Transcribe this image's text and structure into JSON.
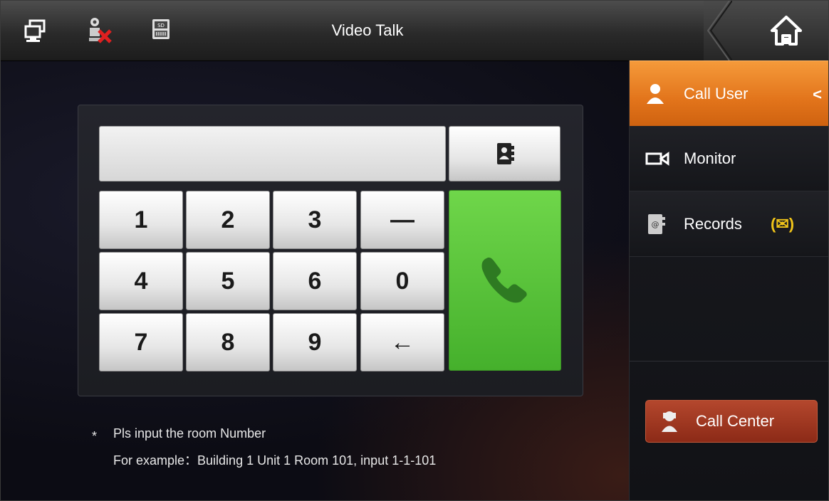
{
  "header": {
    "title": "Video Talk",
    "icons": [
      "windows-icon",
      "camera-error-icon",
      "sd-card-icon",
      "home-icon"
    ]
  },
  "keypad": {
    "input_value": "",
    "keys": [
      "1",
      "2",
      "3",
      "—",
      "4",
      "5",
      "6",
      "0",
      "7",
      "8",
      "9",
      "←"
    ],
    "contact_icon": "contacts-book-icon",
    "call_icon": "phone-handset-icon"
  },
  "hint": {
    "star": "*",
    "line1": "Pls input the room Number",
    "line2": "For example：Building 1 Unit 1 Room 101, input 1-1-101"
  },
  "sidebar": {
    "items": [
      {
        "label": "Call User",
        "icon": "user-icon",
        "active": true,
        "arrow": "<"
      },
      {
        "label": "Monitor",
        "icon": "video-camera-icon",
        "active": false
      },
      {
        "label": "Records",
        "icon": "records-icon",
        "active": false,
        "badge": "(✉)"
      }
    ],
    "call_center": {
      "label": "Call Center",
      "icon": "operator-icon"
    }
  },
  "colors": {
    "accent_orange": "#e2741b",
    "call_green": "#5cc43c",
    "call_center_red": "#a23a22"
  }
}
